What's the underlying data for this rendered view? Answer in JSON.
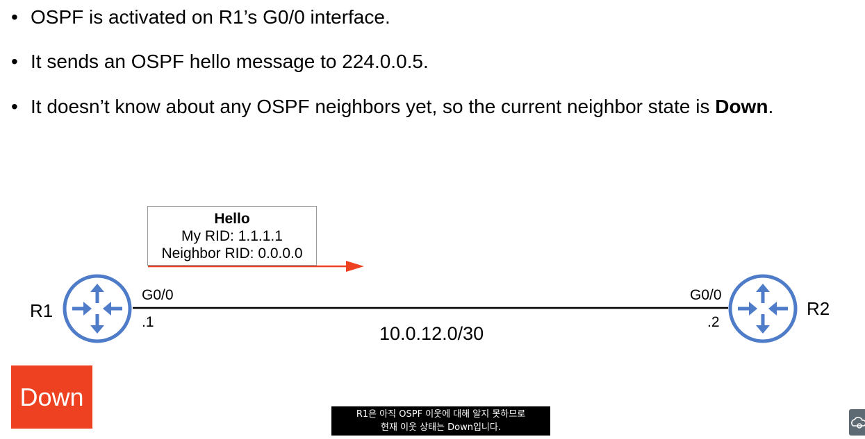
{
  "bullets": [
    {
      "text": "OSPF is activated on R1’s G0/0 interface."
    },
    {
      "text": "It sends an OSPF hello message to 224.0.0.5."
    },
    {
      "text_before": "It doesn’t know about any OSPF neighbors yet, so the current neighbor state is ",
      "bold": "Down",
      "text_after": "."
    }
  ],
  "bullet_glyph": "•",
  "hello_packet": {
    "title": "Hello",
    "my_rid": "My RID: 1.1.1.1",
    "neighbor_rid": "Neighbor RID: 0.0.0.0"
  },
  "r1": {
    "name": "R1",
    "interface": "G0/0",
    "address": ".1",
    "icon": "router-icon"
  },
  "r2": {
    "name": "R2",
    "interface": "G0/0",
    "address": ".2",
    "icon": "router-icon"
  },
  "link": {
    "network": "10.0.12.0/30"
  },
  "neighbor_state": "Down",
  "subtitle": {
    "line1": "R1은 아직 OSPF 이웃에 대해 알지 못하므로",
    "line2": "현재 이웃 상태는 Down입니다."
  },
  "colors": {
    "router": "#4f7cc8",
    "arrow": "#ee4122",
    "state_box": "#ee4122",
    "link": "#000000"
  },
  "corner_icon": "cloud-gear-icon"
}
